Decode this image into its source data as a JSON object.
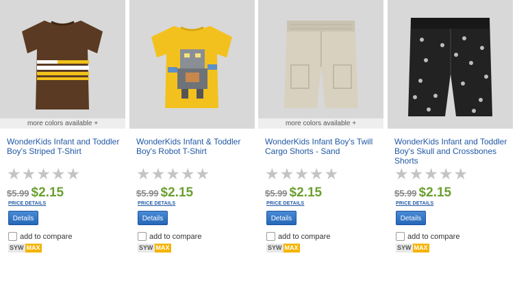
{
  "products": [
    {
      "title": "WonderKids Infant and Toddler Boy's Striped T-Shirt",
      "image_icon": "striped-tshirt-image",
      "more_colors": "more colors available +",
      "rating": 0,
      "old_price": "$5.99",
      "new_price": "$2.15",
      "price_details": "PRICE DETAILS",
      "details_label": "Details",
      "compare_label": "add to compare",
      "badge_left": "SYW",
      "badge_right": "MAX"
    },
    {
      "title": "WonderKids Infant & Toddler Boy's Robot T-Shirt",
      "image_icon": "robot-tshirt-image",
      "more_colors": "",
      "rating": 0,
      "old_price": "$5.99",
      "new_price": "$2.15",
      "price_details": "PRICE DETAILS",
      "details_label": "Details",
      "compare_label": "add to compare",
      "badge_left": "SYW",
      "badge_right": "MAX"
    },
    {
      "title": "WonderKids Infant Boy's Twill Cargo Shorts - Sand",
      "image_icon": "cargo-shorts-image",
      "more_colors": "more colors available +",
      "rating": 0,
      "old_price": "$5.99",
      "new_price": "$2.15",
      "price_details": "PRICE DETAILS",
      "details_label": "Details",
      "compare_label": "add to compare",
      "badge_left": "SYW",
      "badge_right": "MAX"
    },
    {
      "title": "WonderKids Infant and Toddler Boy's Skull and Crossbones Shorts",
      "image_icon": "skull-shorts-image",
      "more_colors": "",
      "rating": 0,
      "old_price": "$5.99",
      "new_price": "$2.15",
      "price_details": "PRICE DETAILS",
      "details_label": "Details",
      "compare_label": "add to compare",
      "badge_left": "SYW",
      "badge_right": "MAX"
    }
  ],
  "colors": {
    "title_link": "#1f57a4",
    "sale_price": "#6a9f2f",
    "button": "#2567b8",
    "badge_max": "#f5b400"
  }
}
